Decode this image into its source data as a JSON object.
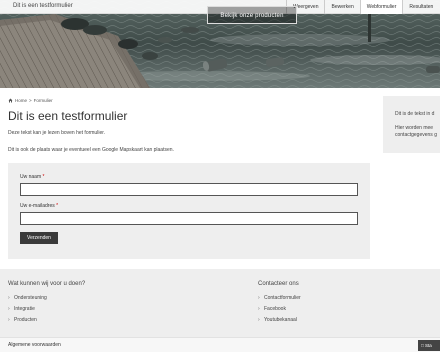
{
  "header": {
    "site_title": "Dit is een testformulier",
    "nav": [
      "Weergeven",
      "Bewerken",
      "Webformulier",
      "Resultaten"
    ],
    "active_nav": "Webformulier",
    "cta_label": "Bekijk onze producten"
  },
  "breadcrumb": {
    "home": "Home",
    "separator": ">",
    "current": "Formulier"
  },
  "main": {
    "title": "Dit is een testformulier",
    "intro": "Deze tekst kan je lezen boven het formulier.",
    "intro2": "Dit is ook de plaats waar je eventueel een Google Mapskaart kan plaatsen."
  },
  "form": {
    "name_label": "Uw naam",
    "email_label": "Uw e-mailadres",
    "required_mark": "*",
    "name_value": "",
    "email_value": "",
    "submit_label": "Verzenden"
  },
  "sidebar": {
    "line1": "Dit is de tekst in d",
    "line2": "Hier worden mee",
    "line3": "contactgegevens g"
  },
  "footer": {
    "col1": {
      "heading": "Wat kunnen wij voor u doen?",
      "links": [
        "Ondersteuning",
        "Integratie",
        "Producten"
      ]
    },
    "col2": {
      "heading": "Contacteer ons",
      "links": [
        "Contactformulier",
        "Facebook",
        "Youtubekanaal"
      ]
    },
    "terms": "Algemene voorwaarden",
    "chat_label": "Sta"
  },
  "colors": {
    "panel_bg": "#eeeeee",
    "button_bg": "#3a3a3a",
    "required": "#cc0000"
  }
}
